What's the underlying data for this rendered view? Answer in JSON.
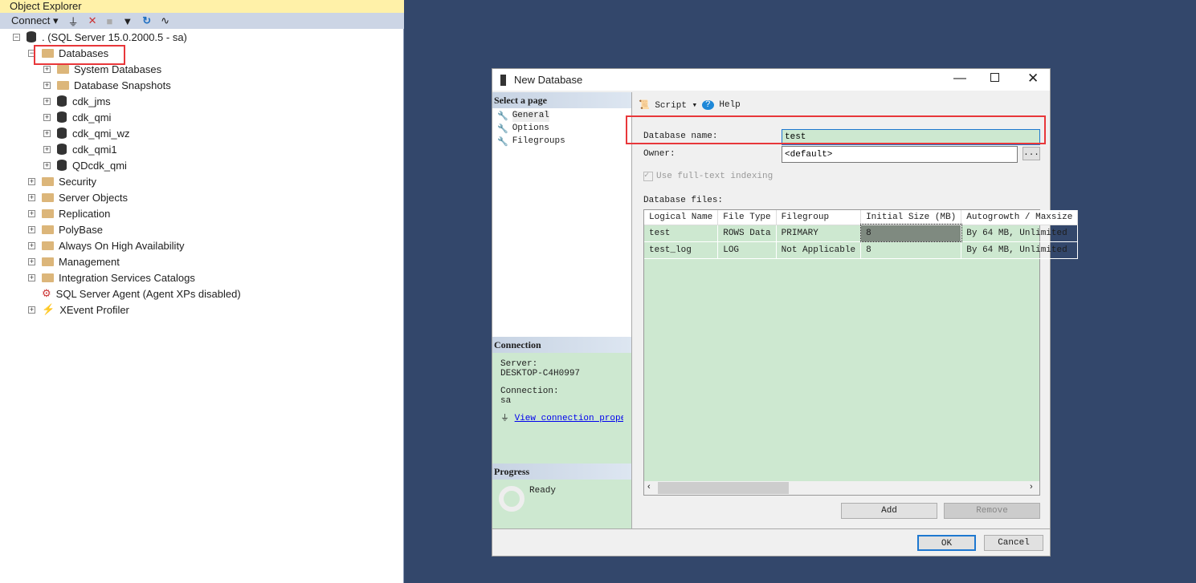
{
  "object_explorer": {
    "title": "Object Explorer",
    "toolbar": {
      "connect_label": "Connect",
      "icons": [
        "connect-icon",
        "disconnect-icon",
        "stop-icon",
        "filter-icon",
        "refresh-icon",
        "activity-monitor-icon"
      ]
    },
    "server": ". (SQL Server 15.0.2000.5 - sa)",
    "databases": "Databases",
    "database_children": [
      "System Databases",
      "Database Snapshots",
      "cdk_jms",
      "cdk_qmi",
      "cdk_qmi_wz",
      "cdk_qmi1",
      "QDcdk_qmi"
    ],
    "server_children": [
      "Security",
      "Server Objects",
      "Replication",
      "PolyBase",
      "Always On High Availability",
      "Management",
      "Integration Services Catalogs"
    ],
    "agent": "SQL Server Agent (Agent XPs disabled)",
    "xevent": "XEvent Profiler"
  },
  "dialog": {
    "title": "New Database",
    "select_page": "Select a page",
    "pages": [
      "General",
      "Options",
      "Filegroups"
    ],
    "toolbar": {
      "script": "Script",
      "help": "Help"
    },
    "db_name_label": "Database name:",
    "db_name_value": "test",
    "owner_label": "Owner:",
    "owner_value": "<default>",
    "browse_label": "...",
    "fulltext_label": "Use full-text indexing",
    "fulltext_checked": true,
    "files_label": "Database files:",
    "columns": [
      "Logical Name",
      "File Type",
      "Filegroup",
      "Initial Size (MB)",
      "Autogrowth / Maxsize"
    ],
    "rows": [
      [
        "test",
        "ROWS Data",
        "PRIMARY",
        "8",
        "By 64 MB, Unlimited"
      ],
      [
        "test_log",
        "LOG",
        "Not Applicable",
        "8",
        "By 64 MB, Unlimited"
      ]
    ],
    "add": "Add",
    "remove": "Remove",
    "connection": {
      "header": "Connection",
      "server_label": "Server:",
      "server": "DESKTOP-C4H0997",
      "connection_label": "Connection:",
      "connection": "sa",
      "link": "View connection properties"
    },
    "progress": {
      "header": "Progress",
      "status": "Ready"
    },
    "ok": "OK",
    "cancel": "Cancel"
  }
}
